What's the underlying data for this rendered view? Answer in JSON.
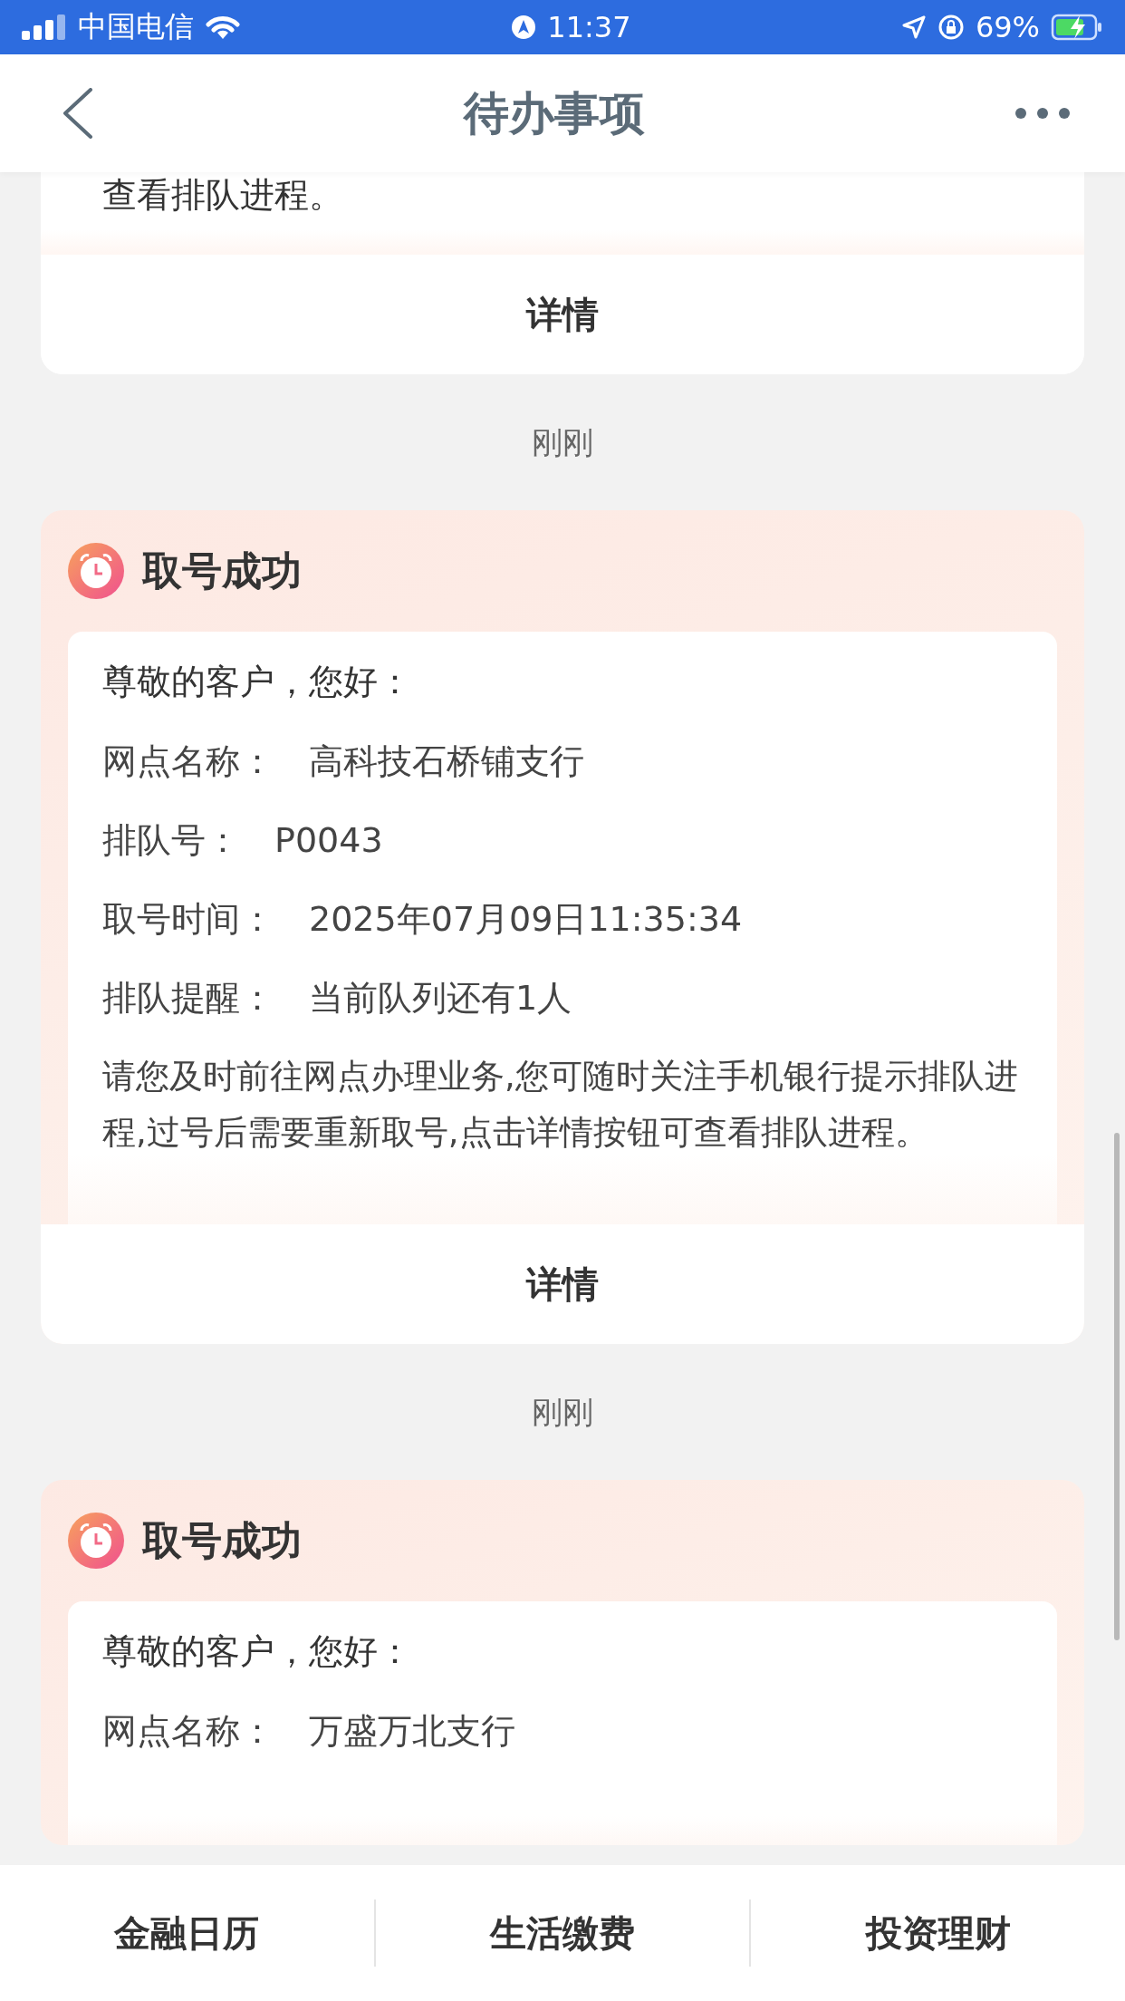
{
  "status_bar": {
    "carrier": "中国电信",
    "time": "11:37",
    "battery": "69%"
  },
  "header": {
    "title": "待办事项"
  },
  "partial_card": {
    "body": "查看排队进程。",
    "button": "详情"
  },
  "messages": [
    {
      "time": "刚刚",
      "title": "取号成功",
      "greeting": "尊敬的客户，您好：",
      "fields": [
        {
          "label": "网点名称：",
          "value": "高科技石桥铺支行"
        },
        {
          "label": "排队号：",
          "value": "P0043"
        },
        {
          "label": "取号时间：",
          "value": "2025年07月09日11:35:34"
        },
        {
          "label": "排队提醒：",
          "value": "当前队列还有1人"
        }
      ],
      "body": "请您及时前往网点办理业务,您可随时关注手机银行提示排队进程,过号后需要重新取号,点击详情按钮可查看排队进程。",
      "button": "详情"
    },
    {
      "time": "刚刚",
      "title": "取号成功",
      "greeting": "尊敬的客户，您好：",
      "fields": [
        {
          "label": "网点名称：",
          "value": "万盛万北支行"
        }
      ]
    }
  ],
  "tabs": [
    "金融日历",
    "生活缴费",
    "投资理财"
  ]
}
